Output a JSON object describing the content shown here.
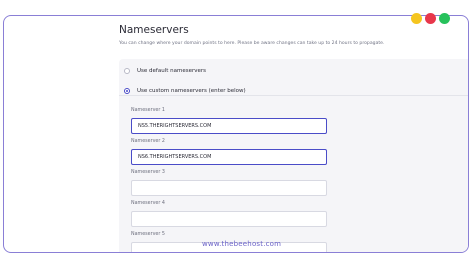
{
  "brand_dots": [
    {
      "name": "yellow",
      "color": "#f5c51f"
    },
    {
      "name": "red",
      "color": "#e8374b"
    },
    {
      "name": "green",
      "color": "#27c15b"
    }
  ],
  "page": {
    "title": "Nameservers",
    "subtitle": "You can change where your domain points to here. Please be aware changes can take up to 24 hours to propagate."
  },
  "options": {
    "default_label": "Use default nameservers",
    "custom_label": "Use custom nameservers (enter below)",
    "selected": "custom"
  },
  "nameservers": [
    {
      "label": "Nameserver 1",
      "value": "NS5.THERIGHTSERVERS.COM"
    },
    {
      "label": "Nameserver 2",
      "value": "NS6.THERIGHTSERVERS.COM"
    },
    {
      "label": "Nameserver 3",
      "value": ""
    },
    {
      "label": "Nameserver 4",
      "value": ""
    },
    {
      "label": "Nameserver 5",
      "value": ""
    }
  ],
  "watermark": "www.thebeehost.com",
  "colors": {
    "accent": "#4a4cc8",
    "frame_border": "#8a7fd6"
  }
}
